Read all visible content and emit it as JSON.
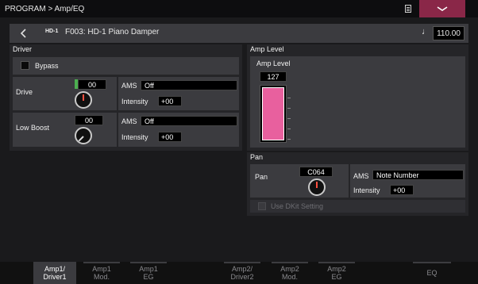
{
  "titlebar": {
    "breadcrumb": "PROGRAM > Amp/EQ",
    "menu_icon": "chevron-down-icon"
  },
  "header": {
    "badge": "HD-1",
    "program": "F003: HD-1 Piano Damper",
    "tempo_icon": "♩",
    "tempo": "110.00"
  },
  "driver": {
    "title": "Driver",
    "bypass_label": "Bypass",
    "drive": {
      "label": "Drive",
      "value": "00",
      "ams_label": "AMS",
      "ams_value": "Off",
      "intensity_label": "Intensity",
      "intensity_value": "+00"
    },
    "low_boost": {
      "label": "Low Boost",
      "value": "00",
      "ams_label": "AMS",
      "ams_value": "Off",
      "intensity_label": "Intensity",
      "intensity_value": "+00"
    }
  },
  "amp_level": {
    "title": "Amp Level",
    "label": "Amp Level",
    "value": "127",
    "bar_fill": 1.0,
    "bar_color": "#e8609e"
  },
  "pan": {
    "title": "Pan",
    "label": "Pan",
    "value": "C064",
    "ams_label": "AMS",
    "ams_value": "Note Number",
    "intensity_label": "Intensity",
    "intensity_value": "+00",
    "use_dkit_label": "Use DKit Setting"
  },
  "tabs": [
    {
      "l1": "Amp1/",
      "l2": "Driver1"
    },
    {
      "l1": "Amp1",
      "l2": "Mod."
    },
    {
      "l1": "Amp1",
      "l2": "EG"
    },
    {
      "l1": "Amp2/",
      "l2": "Driver2"
    },
    {
      "l1": "Amp2",
      "l2": "Mod."
    },
    {
      "l1": "Amp2",
      "l2": "EG"
    },
    {
      "l1": "EQ",
      "l2": ""
    }
  ],
  "colors": {
    "accent": "#8a2748",
    "meter": "#e8609e",
    "value_green": "#4caf50"
  }
}
